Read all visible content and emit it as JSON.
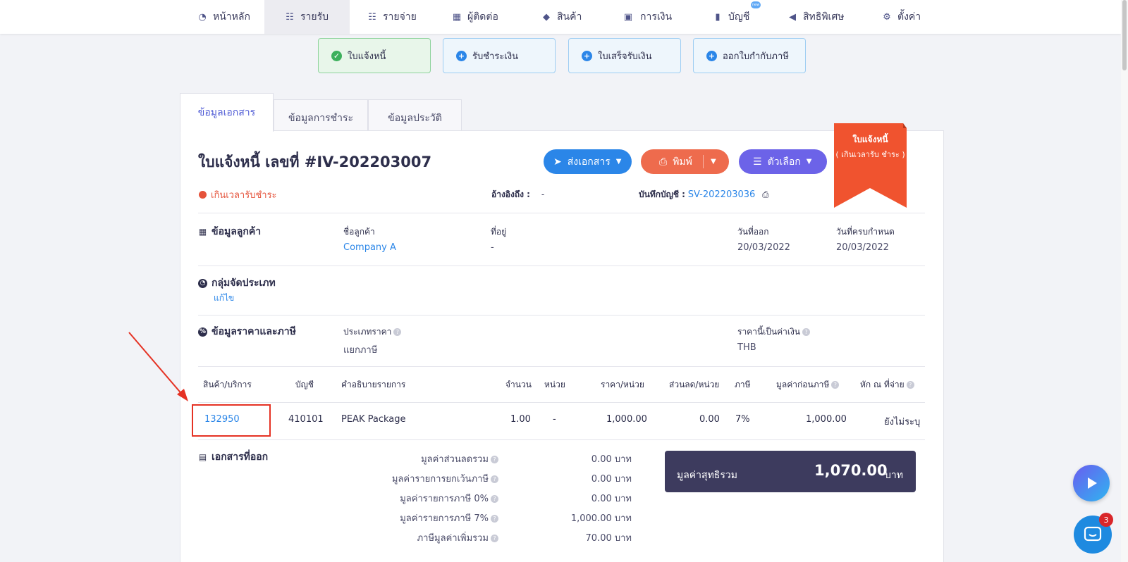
{
  "nav": {
    "items": [
      {
        "label": "หน้าหลัก",
        "icon": "dashboard-icon",
        "active": false
      },
      {
        "label": "รายรับ",
        "icon": "income-list-icon",
        "active": true
      },
      {
        "label": "รายจ่าย",
        "icon": "expense-list-icon",
        "active": false
      },
      {
        "label": "ผู้ติดต่อ",
        "icon": "contacts-building-icon",
        "active": false
      },
      {
        "label": "สินค้า",
        "icon": "product-box-icon",
        "active": false
      },
      {
        "label": "การเงิน",
        "icon": "money-icon",
        "active": false
      },
      {
        "label": "บัญชี",
        "icon": "book-icon",
        "active": false
      },
      {
        "label": "สิทธิพิเศษ",
        "icon": "megaphone-icon",
        "active": false
      },
      {
        "label": "ตั้งค่า",
        "icon": "gear-icon",
        "active": false
      }
    ]
  },
  "actions": [
    {
      "label": "ใบแจ้งหนี้",
      "icon": "check-circle-icon",
      "active": true
    },
    {
      "label": "รับชำระเงิน",
      "icon": "plus-circle-icon",
      "active": false
    },
    {
      "label": "ใบเสร็จรับเงิน",
      "icon": "plus-circle-icon",
      "active": false
    },
    {
      "label": "ออกใบกำกับภาษี",
      "icon": "plus-circle-icon",
      "active": false
    }
  ],
  "tabs": [
    {
      "label": "ข้อมูลเอกสาร",
      "active": true
    },
    {
      "label": "ข้อมูลการชำระ",
      "active": false
    },
    {
      "label": "ข้อมูลประวัติ",
      "active": false
    }
  ],
  "document": {
    "title": "ใบแจ้งหนี้ เลขที่ #IV-202203007",
    "status": "เกินเวลารับชำระ",
    "reference_label": "อ้างอิงถึง :",
    "reference_value": "-",
    "journal_label": "บันทึกบัญชี :",
    "journal_value": "SV-202203036"
  },
  "buttons": {
    "send": "ส่งเอกสาร",
    "print": "พิมพ์",
    "options": "ตัวเลือก"
  },
  "ribbon": {
    "title": "ใบแจ้งหนี้",
    "subtitle": "( เกินเวลารับ ชำระ )",
    "color": "#f0532f"
  },
  "customer": {
    "section": "ข้อมูลลูกค้า",
    "name_label": "ชื่อลูกค้า",
    "name": "Company A",
    "address_label": "ที่อยู่",
    "address": "-",
    "issue_label": "วันที่ออก",
    "issue_date": "20/03/2022",
    "due_label": "วันที่ครบกำหนด",
    "due_date": "20/03/2022"
  },
  "category": {
    "section": "กลุ่มจัดประเภท",
    "edit": "แก้ไข"
  },
  "pricing": {
    "section": "ข้อมูลราคาและภาษี",
    "price_type_label": "ประเภทราคา",
    "price_type": "แยกภาษี",
    "currency_label": "ราคานี้เป็นค่าเงิน",
    "currency": "THB"
  },
  "table": {
    "headers": [
      "สินค้า/บริการ",
      "บัญชี",
      "คำอธิบายรายการ",
      "จำนวน",
      "หน่วย",
      "ราคา/หน่วย",
      "ส่วนลด/หน่วย",
      "ภาษี",
      "มูลค่าก่อนภาษี",
      "หัก ณ ที่จ่าย"
    ],
    "row": {
      "product": "132950",
      "account": "410101",
      "description": "PEAK Package",
      "qty": "1.00",
      "unit": "-",
      "price": "1,000.00",
      "discount": "0.00",
      "tax": "7%",
      "pre_tax": "1,000.00",
      "withholding": "ยังไม่ระบุ"
    }
  },
  "issued_docs": {
    "section": "เอกสารที่ออก"
  },
  "summary": {
    "rows": [
      {
        "label": "มูลค่าส่วนลดรวม",
        "value": "0.00 บาท"
      },
      {
        "label": "มูลค่ารายการยกเว้นภาษี",
        "value": "0.00 บาท"
      },
      {
        "label": "มูลค่ารายการภาษี 0%",
        "value": "0.00 บาท"
      },
      {
        "label": "มูลค่ารายการภาษี 7%",
        "value": "1,000.00 บาท"
      },
      {
        "label": "ภาษีมูลค่าเพิ่มรวม",
        "value": "70.00 บาท"
      }
    ],
    "total_label": "มูลค่าสุทธิรวม",
    "total_value": "1,070.00",
    "total_unit": "บาท"
  },
  "chat": {
    "badge": "3"
  },
  "colors": {
    "accent_blue": "#2b86e8",
    "print_orange": "#ee6b4d",
    "option_purple": "#6c63e8",
    "overdue_red": "#e5533b",
    "total_dark": "#3d3b5e"
  }
}
